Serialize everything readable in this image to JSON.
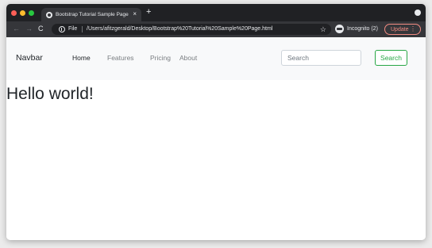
{
  "browser": {
    "tab": {
      "title": "Bootstrap Tutorial Sample Page",
      "close_glyph": "×"
    },
    "new_tab_glyph": "+",
    "toolbar": {
      "back_glyph": "←",
      "forward_glyph": "→",
      "reload_glyph": "C",
      "scheme_label": "File",
      "url": "/Users/afitzgerald/Desktop/Bootstrap%20Tutorial%20Sample%20Page.html",
      "bookmark_glyph": "☆",
      "incognito_label": "Incognito (2)",
      "update_label": "Update",
      "update_menu_glyph": "⋮"
    },
    "icons": [
      "tab-favicon-icon",
      "info-icon",
      "star-icon",
      "incognito-icon",
      "menu-dots-icon"
    ],
    "colors": {
      "titlebar": "#202124",
      "toolbar": "#35363a",
      "update_accent": "#f28b82"
    }
  },
  "page": {
    "navbar": {
      "brand": "Navbar",
      "links": [
        {
          "label": "Home",
          "active": true
        },
        {
          "label": "Features",
          "active": false
        },
        {
          "label": "Pricing",
          "active": false
        },
        {
          "label": "About",
          "active": false
        }
      ],
      "search": {
        "placeholder": "Search",
        "value": ""
      },
      "search_button": "Search"
    },
    "heading": "Hello world!",
    "colors": {
      "navbar_bg": "#f8f9fa",
      "search_button": "#28a745",
      "text": "#212529",
      "muted_link": "#7a7e82"
    }
  }
}
